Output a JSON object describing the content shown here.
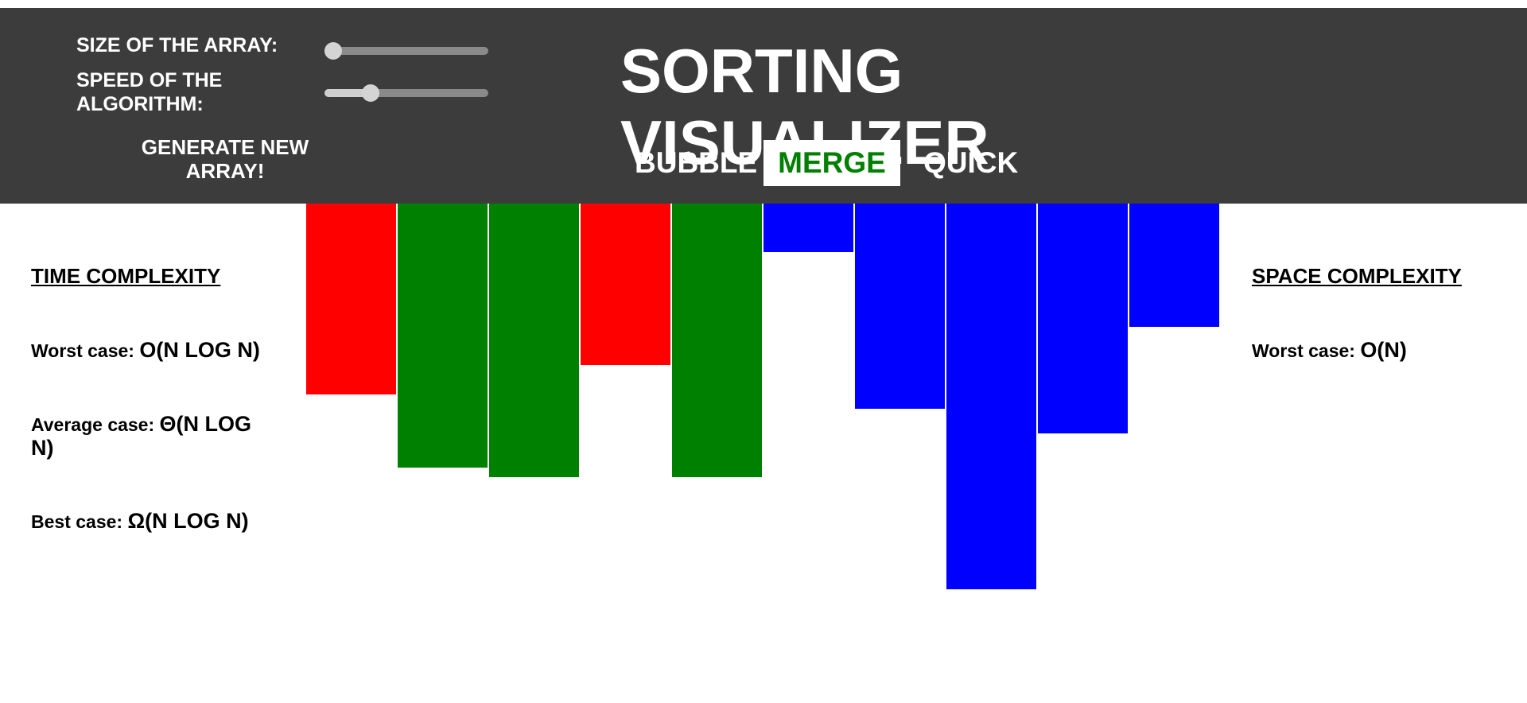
{
  "controls": {
    "size_label": "SIZE OF THE ARRAY:",
    "size_value": 0.05,
    "speed_label_line1": "SPEED OF THE",
    "speed_label_line2": "ALGORITHM:",
    "speed_value": 0.28,
    "generate_line1": "GENERATE NEW",
    "generate_line2": "ARRAY!"
  },
  "title": "SORTING VISUALIZER",
  "algorithms": [
    {
      "label": "BUBBLE",
      "active": false
    },
    {
      "label": "MERGE",
      "active": true
    },
    {
      "label": "QUICK",
      "active": false
    }
  ],
  "colors": {
    "header_bg": "#3c3c3c",
    "active_tab_text": "#008000",
    "bar_red": "#ff0000",
    "bar_green": "#008000",
    "bar_blue": "#0000ff"
  },
  "bars": [
    {
      "value": 240,
      "color": "#ff0000"
    },
    {
      "value": 332,
      "color": "#008000"
    },
    {
      "value": 344,
      "color": "#008000"
    },
    {
      "value": 203,
      "color": "#ff0000"
    },
    {
      "value": 344,
      "color": "#008000"
    },
    {
      "value": 61,
      "color": "#0000ff"
    },
    {
      "value": 258,
      "color": "#0000ff"
    },
    {
      "value": 485,
      "color": "#0000ff"
    },
    {
      "value": 289,
      "color": "#0000ff"
    },
    {
      "value": 155,
      "color": "#0000ff"
    }
  ],
  "time_complexity": {
    "title": "TIME COMPLEXITY",
    "worst_label": "Worst case:",
    "worst_value": "O(N LOG N)",
    "average_label": "Average case:",
    "average_value": "Θ(N LOG",
    "average_value_cont": "N)",
    "best_label": "Best case:",
    "best_value": "Ω(N LOG N)"
  },
  "space_complexity": {
    "title": "SPACE COMPLEXITY",
    "worst_label": "Worst case:",
    "worst_value": "O(N)"
  }
}
